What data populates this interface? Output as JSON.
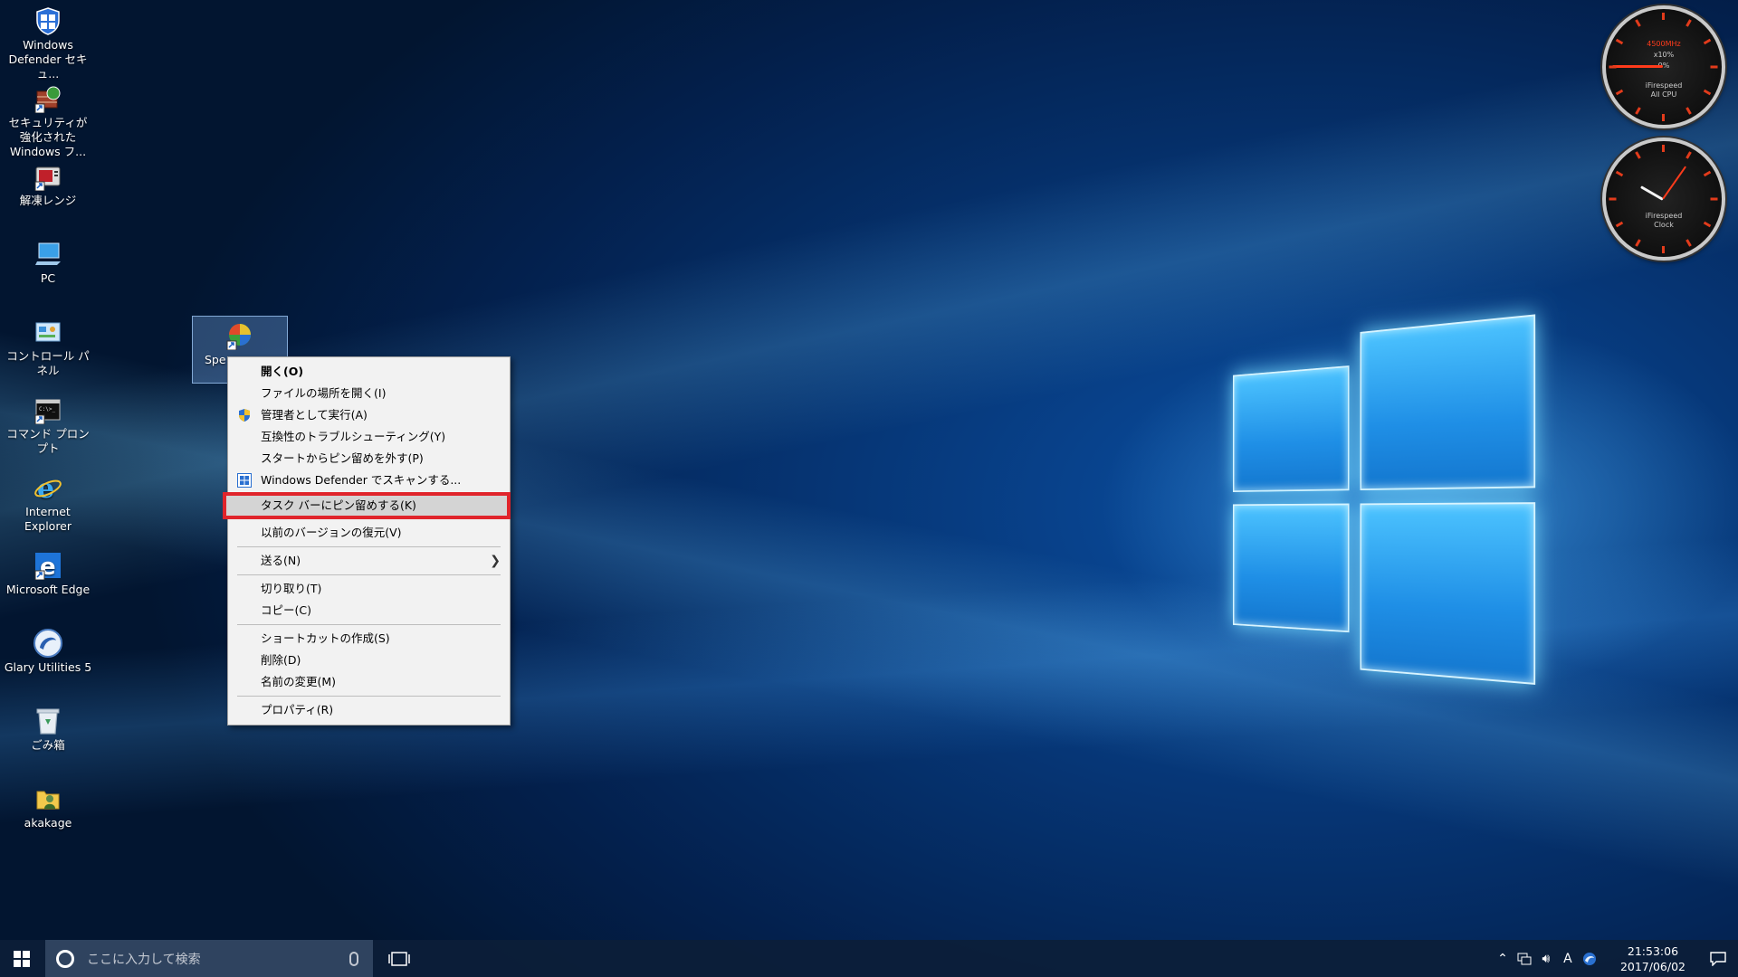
{
  "desktop": {
    "icons": [
      {
        "label": "Windows Defender セキュ...",
        "icon": "windows-defender-icon"
      },
      {
        "label": "セキュリティが強化された Windows フ...",
        "icon": "firewall-icon"
      },
      {
        "label": "解凍レンジ",
        "icon": "decompress-range-icon"
      },
      {
        "label": "PC",
        "icon": "pc-icon"
      },
      {
        "label": "コントロール パネル",
        "icon": "control-panel-icon"
      },
      {
        "label": "コマンド プロンプト",
        "icon": "command-prompt-icon"
      },
      {
        "label": "Internet Explorer",
        "icon": "internet-explorer-icon"
      },
      {
        "label": "Microsoft Edge",
        "icon": "microsoft-edge-icon"
      },
      {
        "label": "Glary Utilities 5",
        "icon": "glary-utilities-icon"
      },
      {
        "label": "ごみ箱",
        "icon": "recycle-bin-icon"
      },
      {
        "label": "akakage",
        "icon": "user-folder-icon"
      }
    ],
    "selected_icon": {
      "label": "Spe",
      "icon": "shortcut-app-icon"
    }
  },
  "context_menu": {
    "items": [
      {
        "label": "開く(O)"
      },
      {
        "label": "ファイルの場所を開く(I)"
      },
      {
        "label": "管理者として実行(A)",
        "icon": "uac-shield-icon"
      },
      {
        "label": "互換性のトラブルシューティング(Y)"
      },
      {
        "label": "スタートからピン留めを外す(P)"
      },
      {
        "label": "Windows Defender でスキャンする...",
        "icon": "windows-defender-icon"
      },
      {
        "label": "タスク バーにピン留めする(K)"
      },
      {
        "label": "以前のバージョンの復元(V)"
      },
      {
        "label": "送る(N)"
      },
      {
        "label": "切り取り(T)"
      },
      {
        "label": "コピー(C)"
      },
      {
        "label": "ショートカットの作成(S)"
      },
      {
        "label": "削除(D)"
      },
      {
        "label": "名前の変更(M)"
      },
      {
        "label": "プロパティ(R)"
      }
    ],
    "highlight_color": "#e0242b"
  },
  "gadgets": {
    "cpu": {
      "freq": "4500MHz",
      "pct": "x10%",
      "zero": "0%",
      "brand": "iFirespeed",
      "label": "All CPU"
    },
    "clock": {
      "brand": "iFirespeed",
      "label": "Clock"
    }
  },
  "taskbar": {
    "search_placeholder": "ここに入力して検索",
    "ime": "A",
    "time": "21:53:06",
    "date": "2017/06/02"
  },
  "colors": {
    "accent": "#1f8fe6",
    "taskbar": "#0c1e38",
    "menu_bg": "#f2f2f2"
  }
}
